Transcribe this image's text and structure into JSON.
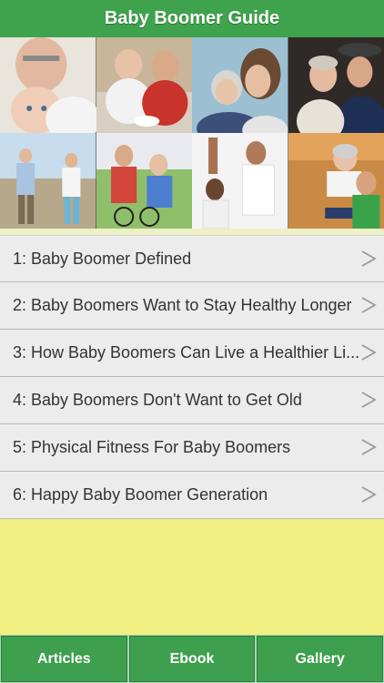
{
  "header": {
    "title": "Baby Boomer Guide"
  },
  "colors": {
    "header": "#3fa34d",
    "background": "#f1ef82",
    "tab": "#3e9f4e",
    "row": "#ececec"
  },
  "articles": [
    {
      "label": "1: Baby Boomer Defined"
    },
    {
      "label": "2: Baby Boomers Want to Stay Healthy Longer"
    },
    {
      "label": "3: How Baby Boomers Can Live a Healthier Li..."
    },
    {
      "label": "4: Baby Boomers Don't Want to Get Old"
    },
    {
      "label": "5: Physical Fitness For Baby Boomers"
    },
    {
      "label": "6: Happy Baby Boomer Generation"
    }
  ],
  "chevron_icon": "chevron-right-icon",
  "tabs": [
    {
      "label": "Articles"
    },
    {
      "label": "Ebook"
    },
    {
      "label": "Gallery"
    }
  ]
}
